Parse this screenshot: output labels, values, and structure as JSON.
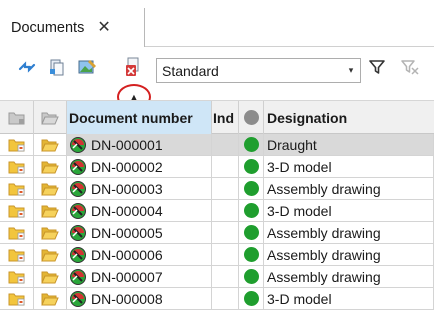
{
  "tab": {
    "label": "Documents",
    "close_glyph": "✕"
  },
  "toolbar": {
    "icons": [
      "link-arrows-icon",
      "document-stack-icon",
      "image-edit-icon",
      "document-delete-icon"
    ],
    "view_select": {
      "value": "Standard",
      "arrow": "▾"
    },
    "filter_icon": "filter-icon",
    "clear_filter_icon": "filter-clear-icon"
  },
  "sort_indicator": "▲",
  "grid": {
    "columns": [
      {
        "key": "icon1",
        "label": ""
      },
      {
        "key": "icon2",
        "label": ""
      },
      {
        "key": "doc",
        "label": "Document number"
      },
      {
        "key": "ind",
        "label": "Ind"
      },
      {
        "key": "status",
        "label": ""
      },
      {
        "key": "des",
        "label": "Designation"
      }
    ],
    "rows": [
      {
        "doc": "DN-000001",
        "ind": "",
        "des": "Draught",
        "selected": true
      },
      {
        "doc": "DN-000002",
        "ind": "",
        "des": "3-D model",
        "selected": false
      },
      {
        "doc": "DN-000003",
        "ind": "",
        "des": "Assembly drawing",
        "selected": false
      },
      {
        "doc": "DN-000004",
        "ind": "",
        "des": "3-D model",
        "selected": false
      },
      {
        "doc": "DN-000005",
        "ind": "",
        "des": "Assembly drawing",
        "selected": false
      },
      {
        "doc": "DN-000006",
        "ind": "",
        "des": "Assembly drawing",
        "selected": false
      },
      {
        "doc": "DN-000007",
        "ind": "",
        "des": "Assembly drawing",
        "selected": false
      },
      {
        "doc": "DN-000008",
        "ind": "",
        "des": "3-D model",
        "selected": false
      }
    ]
  },
  "colors": {
    "status_green": "#1f9e2e",
    "sorted_header": "#cfe6f7",
    "selected_row": "#d9d9d9",
    "folder": "#f2c53d",
    "accent_red": "#d42020"
  }
}
